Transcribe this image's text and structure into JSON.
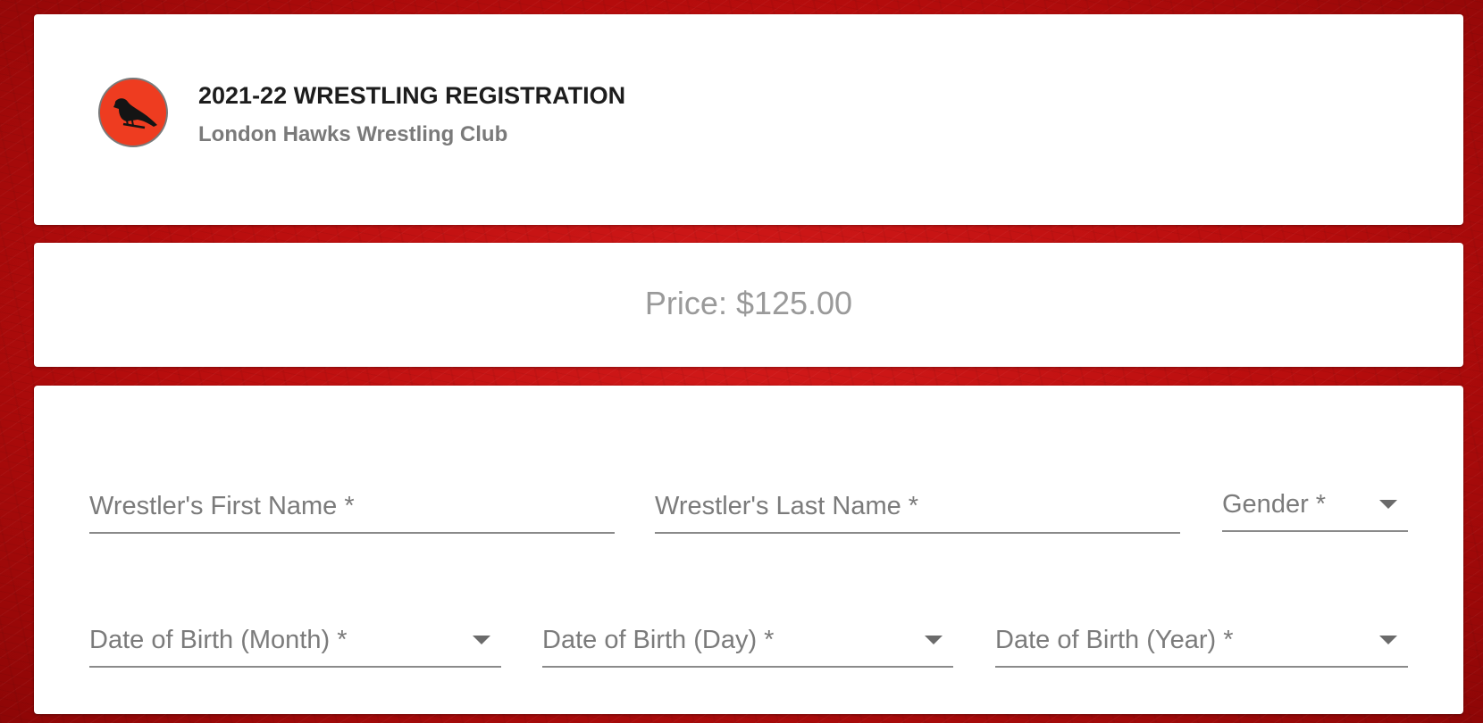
{
  "header": {
    "title": "2021-22 WRESTLING REGISTRATION",
    "club_name": "London Hawks Wrestling Club",
    "logo_icon": "hawk-logo-icon",
    "logo_color": "#ee3c20"
  },
  "pricing": {
    "price_text": "Price: $125.00"
  },
  "form": {
    "first_name_label": "Wrestler's First Name *",
    "last_name_label": "Wrestler's Last Name *",
    "gender_label": "Gender *",
    "dob_month_label": "Date of Birth (Month) *",
    "dob_day_label": "Date of Birth (Day) *",
    "dob_year_label": "Date of Birth (Year) *",
    "dropdown_icon": "arrow-drop-down-icon"
  },
  "colors": {
    "background": "#b40c0c",
    "card": "#ffffff",
    "title": "#1d1d1d",
    "muted": "#7a7a7a"
  }
}
